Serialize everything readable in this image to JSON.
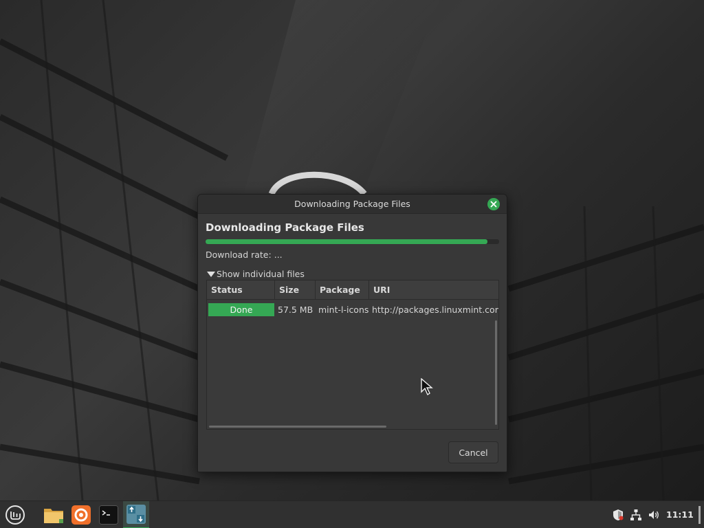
{
  "dialog": {
    "window_title": "Downloading Package Files",
    "heading": "Downloading Package Files",
    "progress_fraction": 0.96,
    "rate_label": "Download rate:",
    "rate_value": "...",
    "expander_label": "Show individual files",
    "columns": [
      "Status",
      "Size",
      "Package",
      "URI"
    ],
    "rows": [
      {
        "status": "Done",
        "size": "57.5 MB",
        "package": "mint-l-icons",
        "uri": "http://packages.linuxmint.com"
      }
    ],
    "cancel_label": "Cancel"
  },
  "taskbar": {
    "apps": [
      "menu-icon",
      "files-icon",
      "firefox-icon",
      "terminal-icon",
      "update-manager-icon"
    ],
    "tray": [
      "shield-icon",
      "network-icon",
      "volume-icon"
    ],
    "clock": "11:11"
  },
  "colors": {
    "accent": "#35a854",
    "dialog_bg": "#383838",
    "panel_bg": "#303030"
  }
}
